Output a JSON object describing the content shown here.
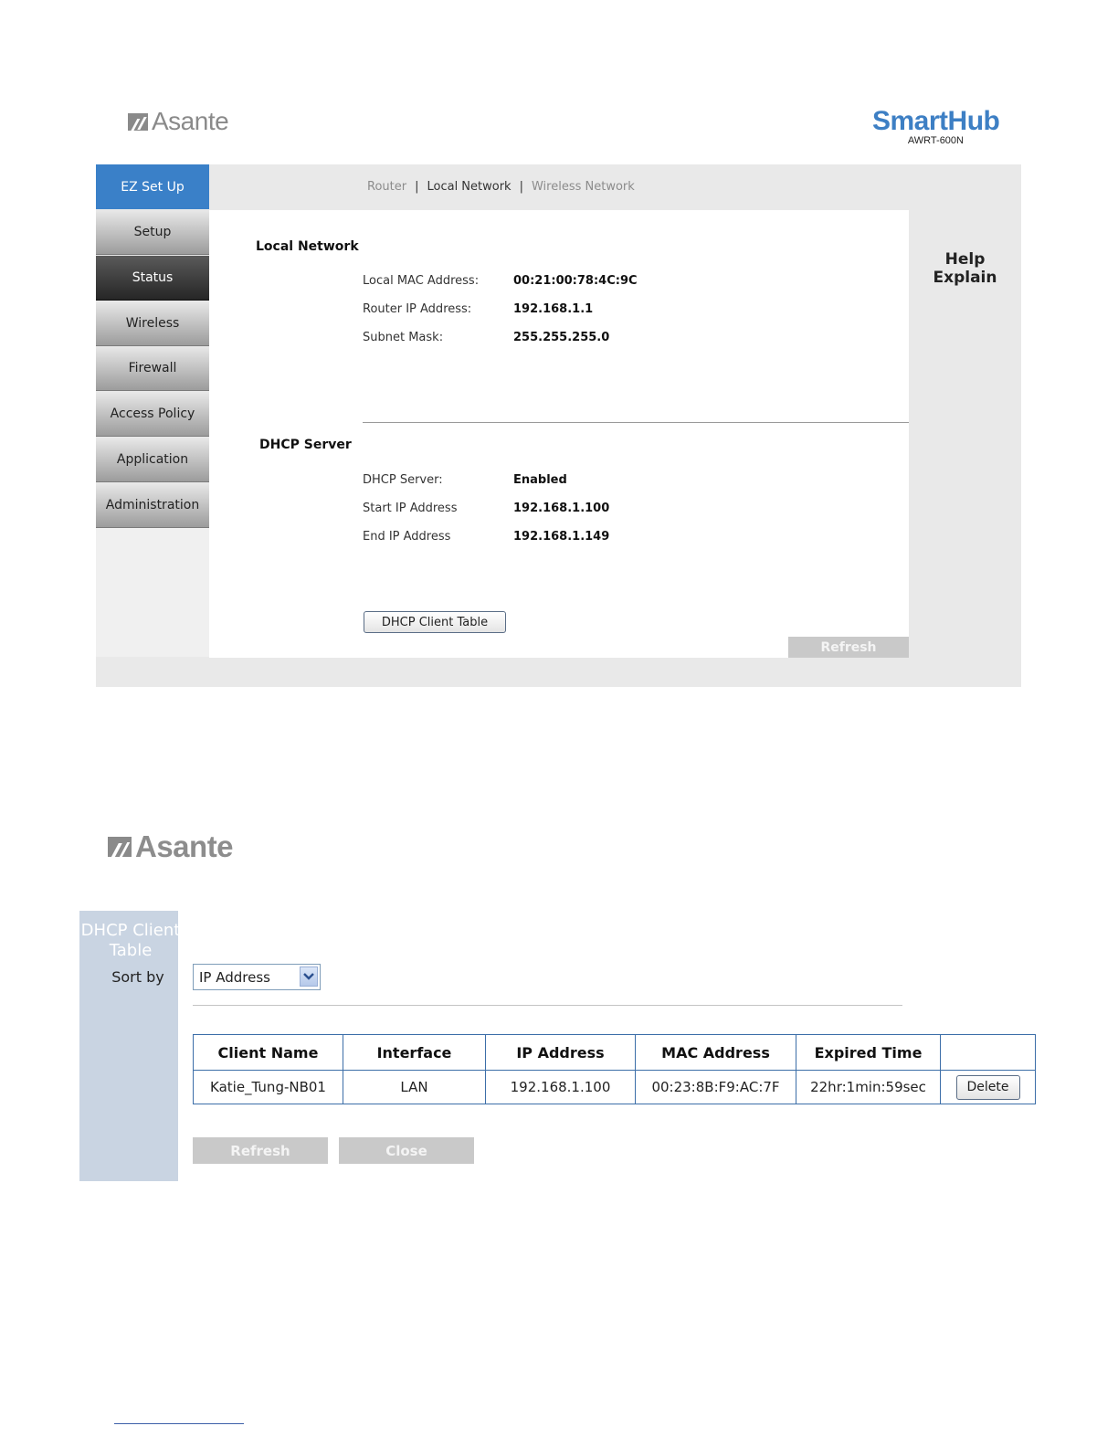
{
  "logo_top": {
    "brand": "Asante"
  },
  "product": {
    "name": "SmartHub",
    "model": "AWRT-600N"
  },
  "sidebar": {
    "items": [
      {
        "label": "EZ Set Up",
        "state": "active"
      },
      {
        "label": "Setup",
        "state": "normal"
      },
      {
        "label": "Status",
        "state": "selected"
      },
      {
        "label": "Wireless",
        "state": "normal"
      },
      {
        "label": "Firewall",
        "state": "normal"
      },
      {
        "label": "Access Policy",
        "state": "normal"
      },
      {
        "label": "Application",
        "state": "normal"
      },
      {
        "label": "Administration",
        "state": "normal"
      }
    ]
  },
  "subnav": {
    "items": [
      "Router",
      "Local Network",
      "Wireless Network"
    ],
    "separator": "|",
    "current": "Local Network"
  },
  "local_network": {
    "title": "Local Network",
    "rows": [
      {
        "label": "Local MAC Address:",
        "value": "00:21:00:78:4C:9C"
      },
      {
        "label": "Router IP Address:",
        "value": "192.168.1.1"
      },
      {
        "label": "Subnet Mask:",
        "value": "255.255.255.0"
      }
    ]
  },
  "dhcp_server": {
    "title": "DHCP Server",
    "rows": [
      {
        "label": "DHCP Server:",
        "value": "Enabled"
      },
      {
        "label": "Start IP Address",
        "value": "192.168.1.100"
      },
      {
        "label": "End IP Address",
        "value": "192.168.1.149"
      }
    ]
  },
  "actions": {
    "client_table_button": "DHCP Client Table",
    "refresh_button": "Refresh"
  },
  "help": {
    "title": "Help",
    "subtitle": "Explain"
  },
  "logo_bottom": {
    "brand": "Asante"
  },
  "client_table_window": {
    "title": "DHCP Client\nTable",
    "sort_label": "Sort by",
    "sort_value": "IP Address",
    "columns": [
      "Client Name",
      "Interface",
      "IP Address",
      "MAC Address",
      "Expired Time",
      ""
    ],
    "rows": [
      {
        "client_name": "Katie_Tung-NB01",
        "interface": "LAN",
        "ip": "192.168.1.100",
        "mac": "00:23:8B:F9:AC:7F",
        "expired": "22hr:1min:59sec",
        "action": "Delete"
      }
    ],
    "refresh_button": "Refresh",
    "close_button": "Close"
  },
  "colors": {
    "brand_blue": "#3a80c8",
    "smarthub_blue": "#3d7fc4",
    "table_border": "#3c6ea8",
    "side_strip": "#c9d4e2"
  }
}
